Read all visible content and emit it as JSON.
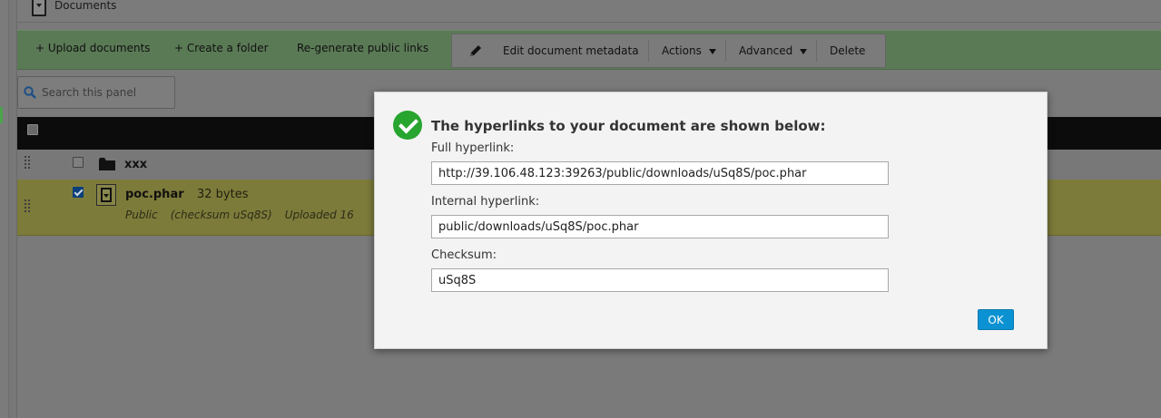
{
  "breadcrumb": {
    "label": "Documents"
  },
  "toolbar": {
    "upload_label": "+ Upload documents",
    "create_folder_label": "+ Create a folder",
    "regenerate_label": "Re-generate public links",
    "edit_metadata_label": "Edit document metadata",
    "actions_label": "Actions",
    "advanced_label": "Advanced",
    "delete_label": "Delete"
  },
  "search": {
    "placeholder": "Search this panel",
    "value": ""
  },
  "table": {
    "rows": [
      {
        "name": "xxx",
        "type": "folder",
        "checked": false
      },
      {
        "name": "poc.phar",
        "size": "32 bytes",
        "visibility": "Public",
        "checksum": "(checksum uSq8S)",
        "uploaded": "Uploaded 16",
        "checked": true
      }
    ]
  },
  "modal": {
    "title": "The hyperlinks to your document are shown below:",
    "full_label": "Full hyperlink:",
    "full_value": "http://39.106.48.123:39263/public/downloads/uSq8S/poc.phar",
    "internal_label": "Internal hyperlink:",
    "internal_value": "public/downloads/uSq8S/poc.phar",
    "checksum_label": "Checksum:",
    "checksum_value": "uSq8S",
    "ok_label": "OK"
  },
  "colors": {
    "toolbar_green": "#5a7a55",
    "selected_row": "#7d7b3a",
    "ok_button": "#0b92d2",
    "success_icon": "#27a52f"
  }
}
